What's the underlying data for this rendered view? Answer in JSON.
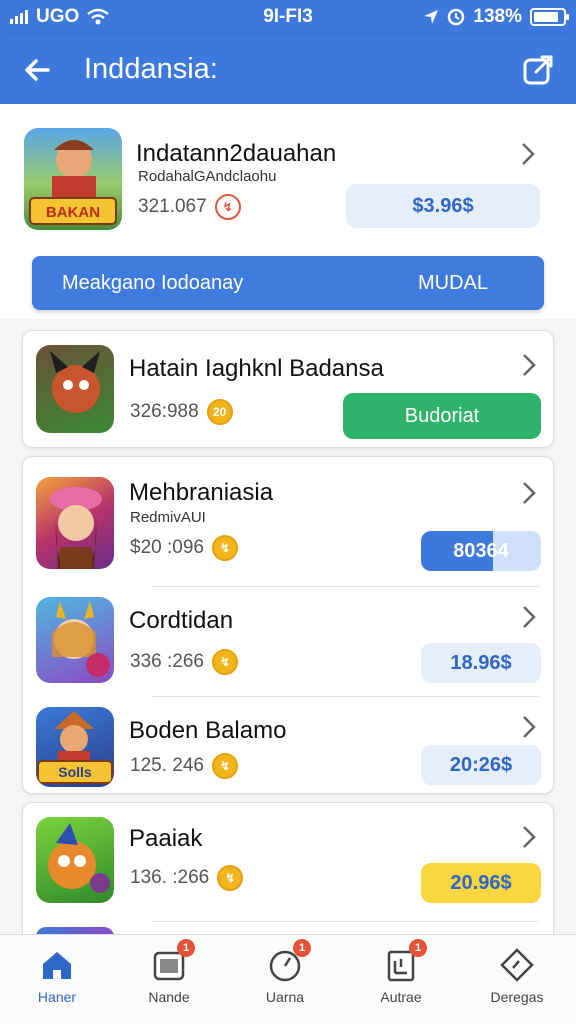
{
  "status_bar": {
    "carrier": "UGO",
    "time": "9I-FI3",
    "battery": "138%"
  },
  "header": {
    "title": "Inddansia:"
  },
  "featured": {
    "title": "Indatann2dauahan",
    "subtitle": "RodahalGAndclaohu",
    "meta": "321.067",
    "price": "$3.96$",
    "thumb_label": "BAKAN"
  },
  "wide_button": {
    "left_label": "Meakgano Iodoanay",
    "right_label": "MUDAL"
  },
  "items": [
    {
      "title": "Hatain Iaghknl Badansa",
      "subtitle": "",
      "meta": "326:988",
      "price": "Budoriat"
    },
    {
      "title": "Mehbraniasia",
      "subtitle": "RedmivAUI",
      "meta": "$20 :096",
      "price": "80364"
    },
    {
      "title": "Cordtidan",
      "subtitle": "",
      "meta": "336 :266",
      "price": "18.96$"
    },
    {
      "title": "Boden Balamo",
      "subtitle": "",
      "meta": "125. 246",
      "price": "20:26$",
      "thumb_label": "Solls"
    },
    {
      "title": "Paaiak",
      "subtitle": "",
      "meta": "136. :266",
      "price": "20.96$"
    }
  ],
  "bottom_nav": [
    {
      "label": "Haner",
      "icon": "home-icon",
      "badge": ""
    },
    {
      "label": "Nande",
      "icon": "gallery-icon",
      "badge": "1"
    },
    {
      "label": "Uarna",
      "icon": "clock-icon",
      "badge": "1"
    },
    {
      "label": "Autrae",
      "icon": "document-icon",
      "badge": "1"
    },
    {
      "label": "Deregas",
      "icon": "tag-icon",
      "badge": ""
    }
  ],
  "colors": {
    "primary": "#3d78dc",
    "green": "#2fb36b",
    "yellow": "#fad641",
    "light_blue": "#e6eefb"
  }
}
